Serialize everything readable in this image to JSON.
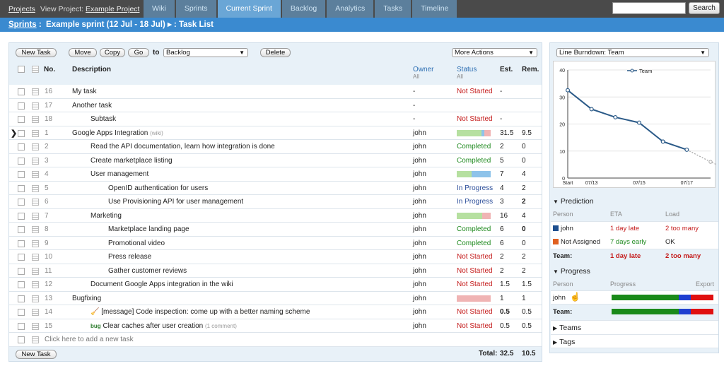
{
  "topnav": {
    "projects_link": "Projects",
    "view_project_prefix": "View Project:",
    "project_link": "Example Project",
    "tabs": [
      "Wiki",
      "Sprints",
      "Current Sprint",
      "Backlog",
      "Analytics",
      "Tasks",
      "Timeline"
    ],
    "active_tab": "Current Sprint",
    "search_button": "Search"
  },
  "titlebar": {
    "sprints_link": "Sprints",
    "sprint_title": "Example sprint (12 Jul - 18 Jul) ▸ : Task List"
  },
  "toolbar": {
    "new_task": "New Task",
    "move": "Move",
    "copy": "Copy",
    "go": "Go",
    "to_label": "to",
    "to_select": "Backlog",
    "delete": "Delete",
    "more_actions": "More Actions"
  },
  "table": {
    "headers": {
      "no": "No.",
      "description": "Description",
      "owner": "Owner",
      "owner_sub": "All",
      "status": "Status",
      "status_sub": "All",
      "est": "Est.",
      "rem": "Rem."
    },
    "rows": [
      {
        "no": "16",
        "desc": "My task",
        "indent": 0,
        "owner": "-",
        "status": "Not Started",
        "est": "-",
        "rem": ""
      },
      {
        "no": "17",
        "desc": "Another task",
        "indent": 0,
        "owner": "-",
        "status": "",
        "est": "",
        "rem": ""
      },
      {
        "no": "18",
        "desc": "Subtask",
        "indent": 1,
        "owner": "-",
        "status": "Not Started",
        "est": "-",
        "rem": ""
      },
      {
        "no": "1",
        "desc": "Google Apps Integration",
        "wiki": "(wiki)",
        "indent": 0,
        "owner": "john",
        "bar": [
          [
            0.72,
            "#b6e0a0"
          ],
          [
            0.1,
            "#8ec3ea"
          ],
          [
            0.18,
            "#f0b4b4"
          ]
        ],
        "est": "31.5",
        "rem": "9.5",
        "current": true
      },
      {
        "no": "2",
        "desc": "Read the API documentation, learn how integration is done",
        "indent": 1,
        "owner": "john",
        "status": "Completed",
        "est": "2",
        "rem": "0"
      },
      {
        "no": "3",
        "desc": "Create marketplace listing",
        "indent": 1,
        "owner": "john",
        "status": "Completed",
        "est": "5",
        "rem": "0"
      },
      {
        "no": "4",
        "desc": "User management",
        "indent": 1,
        "owner": "john",
        "bar": [
          [
            0.43,
            "#b6e0a0"
          ],
          [
            0.57,
            "#8ec3ea"
          ]
        ],
        "est": "7",
        "rem": "4"
      },
      {
        "no": "5",
        "desc": "OpenID authentication for users",
        "indent": 2,
        "owner": "john",
        "status": "In Progress",
        "est": "4",
        "rem": "2"
      },
      {
        "no": "6",
        "desc": "Use Provisioning API for user management",
        "indent": 2,
        "owner": "john",
        "status": "In Progress",
        "est": "3",
        "rem": "2",
        "rem_bold": true
      },
      {
        "no": "7",
        "desc": "Marketing",
        "indent": 1,
        "owner": "john",
        "bar": [
          [
            0.75,
            "#b6e0a0"
          ],
          [
            0.25,
            "#f0b4b4"
          ]
        ],
        "est": "16",
        "rem": "4"
      },
      {
        "no": "8",
        "desc": "Marketplace landing page",
        "indent": 2,
        "owner": "john",
        "status": "Completed",
        "est": "6",
        "rem": "0",
        "rem_bold": true
      },
      {
        "no": "9",
        "desc": "Promotional video",
        "indent": 2,
        "owner": "john",
        "status": "Completed",
        "est": "6",
        "rem": "0"
      },
      {
        "no": "10",
        "desc": "Press release",
        "indent": 2,
        "owner": "john",
        "status": "Not Started",
        "est": "2",
        "rem": "2"
      },
      {
        "no": "11",
        "desc": "Gather customer reviews",
        "indent": 2,
        "owner": "john",
        "status": "Not Started",
        "est": "2",
        "rem": "2"
      },
      {
        "no": "12",
        "desc": "Document Google Apps integration in the wiki",
        "indent": 1,
        "owner": "john",
        "status": "Not Started",
        "est": "1.5",
        "rem": "1.5"
      },
      {
        "no": "13",
        "desc": "Bugfixing",
        "indent": 0,
        "owner": "john",
        "bar": [
          [
            1,
            "#f0b4b4"
          ]
        ],
        "est": "1",
        "rem": "1"
      },
      {
        "no": "14",
        "desc": "[message] Code inspection: come up with a better naming scheme",
        "indent": 1,
        "icon": "broom",
        "owner": "john",
        "status": "Not Started",
        "est": "0.5",
        "est_bold": true,
        "rem": "0.5"
      },
      {
        "no": "15",
        "desc": "Clear caches after user creation",
        "tag": "bug",
        "comment": "(1 comment)",
        "indent": 1,
        "owner": "john",
        "status": "Not Started",
        "est": "0.5",
        "rem": "0.5"
      }
    ],
    "add_row": "Click here to add a new task",
    "footer_new_task": "New Task",
    "total_label": "Total:",
    "total_est": "32.5",
    "total_rem": "10.5"
  },
  "burndown": {
    "select": "Line Burndown: Team",
    "legend": "Team",
    "chart_data": {
      "type": "line",
      "x": [
        "Start",
        "07/13",
        "07/14",
        "07/15",
        "07/16",
        "07/17",
        "07/18"
      ],
      "xticks": [
        "Start",
        "07/13",
        "07/15",
        "07/17"
      ],
      "series": [
        {
          "name": "Team",
          "values": [
            32.5,
            25.5,
            22.5,
            20.5,
            13.5,
            10.5
          ]
        }
      ],
      "projected": [
        10.5,
        6,
        2
      ],
      "ylim": [
        0,
        40
      ],
      "yticks": [
        "0",
        "10",
        "20",
        "30",
        "40"
      ]
    }
  },
  "prediction": {
    "title": "Prediction",
    "cols": [
      "Person",
      "ETA",
      "Load"
    ],
    "rows": [
      {
        "person": "john",
        "color": "#1d4f8f",
        "eta": "1 day late",
        "load": "2 too many",
        "eta_color": "#c41a1a",
        "load_color": "#c41a1a"
      },
      {
        "person": "Not Assigned",
        "color": "#e06020",
        "eta": "7 days early",
        "load": "OK",
        "eta_color": "#1f8a1f",
        "load_color": "#222"
      }
    ],
    "team_label": "Team:",
    "team_eta": "1 day late",
    "team_load": "2 too many"
  },
  "progress": {
    "title": "Progress",
    "cols": [
      "Person",
      "Progress",
      "Export"
    ],
    "rows": [
      {
        "person": "john",
        "done": 0.66,
        "prog": 0.12,
        "left": 0.22
      }
    ],
    "team_label": "Team:",
    "team": {
      "done": 0.66,
      "prog": 0.12,
      "left": 0.22
    }
  },
  "teams": "Teams",
  "tags": "Tags"
}
